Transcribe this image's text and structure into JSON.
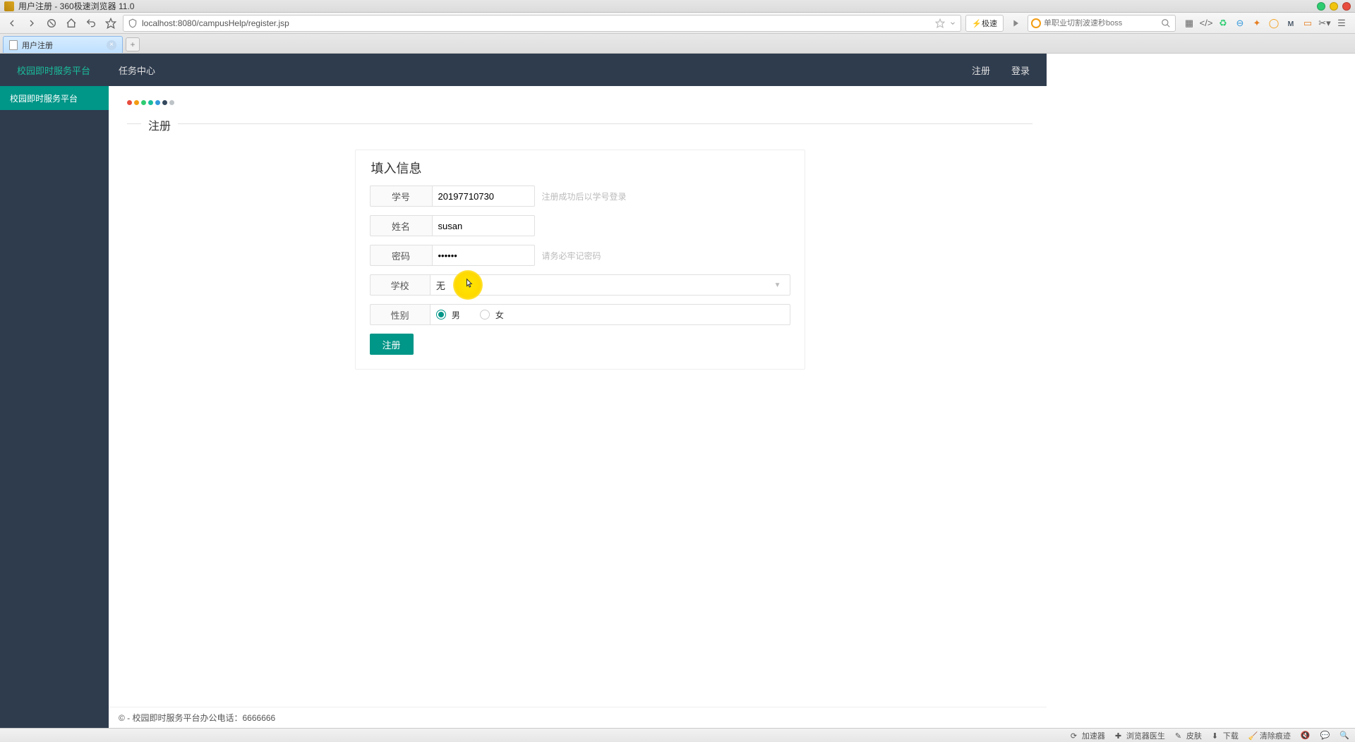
{
  "os": {
    "title": "用户注册 - 360极速浏览器 11.0"
  },
  "browser": {
    "url": "localhost:8080/campusHelp/register.jsp",
    "speed_mode": "⚡极速",
    "search_placeholder": "单职业切割波速秒boss",
    "tab_title": "用户注册"
  },
  "header": {
    "brand": "校园即时服务平台",
    "task_center": "任务中心",
    "register": "注册",
    "login": "登录"
  },
  "sidebar": {
    "item0": "校园即时服务平台"
  },
  "main": {
    "legend_title": "注册",
    "panel_title": "填入信息",
    "labels": {
      "student_id": "学号",
      "name": "姓名",
      "password": "密码",
      "school": "学校",
      "gender": "性别"
    },
    "values": {
      "student_id": "20197710730",
      "name": "susan",
      "password": "••••••",
      "school": "无"
    },
    "hints": {
      "student_id": "注册成功后以学号登录",
      "password": "请务必牢记密码"
    },
    "gender": {
      "male": "男",
      "female": "女"
    },
    "submit": "注册"
  },
  "footer": {
    "text": "© - 校园即时服务平台办公电话：6666666"
  },
  "statusbar": {
    "accelerator": "加速器",
    "doctor": "浏览器医生",
    "skin": "皮肤",
    "download": "下载",
    "clear": "清除痕迹"
  },
  "colors": {
    "dots": [
      "#e74c3c",
      "#f39c12",
      "#2ecc71",
      "#1abc9c",
      "#3498db",
      "#34495e",
      "#bdc3c7"
    ]
  }
}
